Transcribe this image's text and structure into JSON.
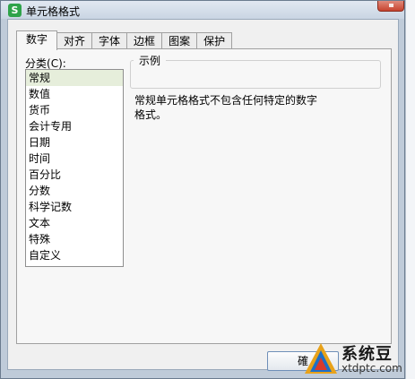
{
  "window": {
    "title": "单元格格式",
    "app_icon_letter": "S"
  },
  "tabs": [
    {
      "label": "数字",
      "active": true
    },
    {
      "label": "对齐",
      "active": false
    },
    {
      "label": "字体",
      "active": false
    },
    {
      "label": "边框",
      "active": false
    },
    {
      "label": "图案",
      "active": false
    },
    {
      "label": "保护",
      "active": false
    }
  ],
  "category": {
    "label": "分类",
    "shortcut": "(C):",
    "items": [
      "常规",
      "数值",
      "货币",
      "会计专用",
      "日期",
      "时间",
      "百分比",
      "分数",
      "科学记数",
      "文本",
      "特殊",
      "自定义"
    ],
    "selected_index": 0
  },
  "sample": {
    "label": "示例",
    "description_line1": "常规单元格格式不包含任何特定的数字",
    "description_line2": "格式。"
  },
  "buttons": {
    "ok_label_visible": "確"
  },
  "watermark": {
    "brand": "系统豆",
    "url": "xtdptc.com"
  },
  "colors": {
    "selected_item_bg": "#e6eedb",
    "app_icon_green": "#2fa34a",
    "close_button_red": "#c7432e"
  }
}
